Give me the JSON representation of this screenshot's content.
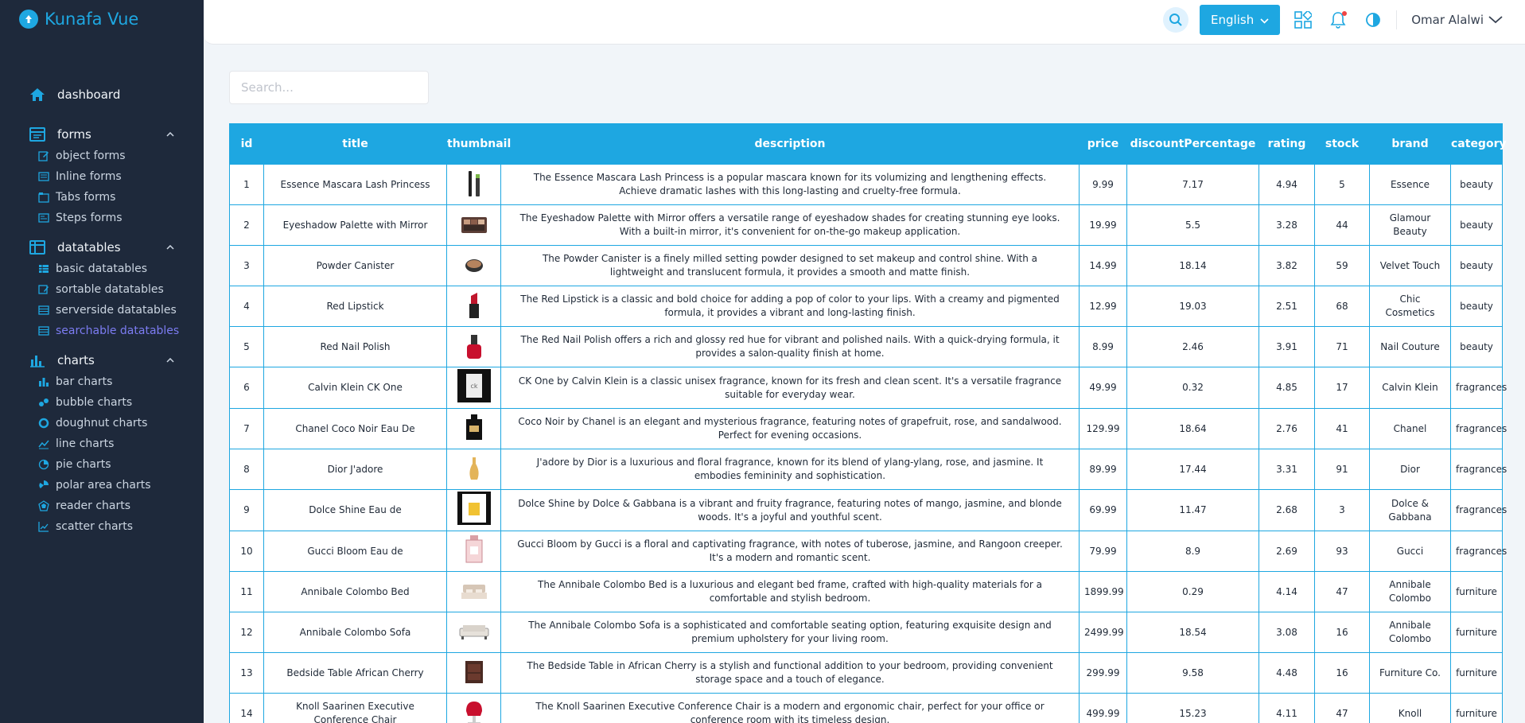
{
  "app": {
    "title": "Kunafa Vue"
  },
  "sidebar": {
    "top": {
      "label": "dashboard",
      "icon": "home-icon"
    },
    "groups": [
      {
        "label": "forms",
        "icon": "forms-icon",
        "items": [
          {
            "label": "object forms",
            "icon": "edit-icon"
          },
          {
            "label": "Inline forms",
            "icon": "inline-icon"
          },
          {
            "label": "Tabs forms",
            "icon": "tabs-icon"
          },
          {
            "label": "Steps forms",
            "icon": "steps-icon"
          }
        ]
      },
      {
        "label": "datatables",
        "icon": "table-icon",
        "items": [
          {
            "label": "basic datatables",
            "icon": "table-icon"
          },
          {
            "label": "sortable datatables",
            "icon": "sort-icon"
          },
          {
            "label": "serverside datatables",
            "icon": "list-icon"
          },
          {
            "label": "searchable datatables",
            "icon": "list-icon",
            "active": true
          }
        ]
      },
      {
        "label": "charts",
        "icon": "bar-chart-icon",
        "items": [
          {
            "label": "bar charts",
            "icon": "bar-chart-icon"
          },
          {
            "label": "bubble charts",
            "icon": "bubble-icon"
          },
          {
            "label": "doughnut charts",
            "icon": "doughnut-icon"
          },
          {
            "label": "line charts",
            "icon": "line-chart-icon"
          },
          {
            "label": "pie charts",
            "icon": "pie-icon"
          },
          {
            "label": "polar area charts",
            "icon": "polar-icon"
          },
          {
            "label": "reader charts",
            "icon": "radar-icon"
          },
          {
            "label": "scatter charts",
            "icon": "scatter-icon"
          }
        ]
      }
    ]
  },
  "header": {
    "language": "English",
    "user_name": "Omar Alalwi"
  },
  "search": {
    "placeholder": "Search...",
    "value": ""
  },
  "table": {
    "columns": [
      "id",
      "title",
      "thumbnail",
      "description",
      "price",
      "discountPercentage",
      "rating",
      "stock",
      "brand",
      "category"
    ],
    "rows": [
      {
        "id": "1",
        "title": "Essence Mascara Lash Princess",
        "thumbnail": "mascara",
        "description": "The Essence Mascara Lash Princess is a popular mascara known for its volumizing and lengthening effects. Achieve dramatic lashes with this long-lasting and cruelty-free formula.",
        "price": "9.99",
        "discountPercentage": "7.17",
        "rating": "4.94",
        "stock": "5",
        "brand": "Essence",
        "category": "beauty"
      },
      {
        "id": "2",
        "title": "Eyeshadow Palette with Mirror",
        "thumbnail": "palette",
        "description": "The Eyeshadow Palette with Mirror offers a versatile range of eyeshadow shades for creating stunning eye looks. With a built-in mirror, it's convenient for on-the-go makeup application.",
        "price": "19.99",
        "discountPercentage": "5.5",
        "rating": "3.28",
        "stock": "44",
        "brand": "Glamour Beauty",
        "category": "beauty"
      },
      {
        "id": "3",
        "title": "Powder Canister",
        "thumbnail": "powder",
        "description": "The Powder Canister is a finely milled setting powder designed to set makeup and control shine. With a lightweight and translucent formula, it provides a smooth and matte finish.",
        "price": "14.99",
        "discountPercentage": "18.14",
        "rating": "3.82",
        "stock": "59",
        "brand": "Velvet Touch",
        "category": "beauty"
      },
      {
        "id": "4",
        "title": "Red Lipstick",
        "thumbnail": "lipstick",
        "description": "The Red Lipstick is a classic and bold choice for adding a pop of color to your lips. With a creamy and pigmented formula, it provides a vibrant and long-lasting finish.",
        "price": "12.99",
        "discountPercentage": "19.03",
        "rating": "2.51",
        "stock": "68",
        "brand": "Chic Cosmetics",
        "category": "beauty"
      },
      {
        "id": "5",
        "title": "Red Nail Polish",
        "thumbnail": "nailpolish",
        "description": "The Red Nail Polish offers a rich and glossy red hue for vibrant and polished nails. With a quick-drying formula, it provides a salon-quality finish at home.",
        "price": "8.99",
        "discountPercentage": "2.46",
        "rating": "3.91",
        "stock": "71",
        "brand": "Nail Couture",
        "category": "beauty"
      },
      {
        "id": "6",
        "title": "Calvin Klein CK One",
        "thumbnail": "ckone",
        "description": "CK One by Calvin Klein is a classic unisex fragrance, known for its fresh and clean scent. It's a versatile fragrance suitable for everyday wear.",
        "price": "49.99",
        "discountPercentage": "0.32",
        "rating": "4.85",
        "stock": "17",
        "brand": "Calvin Klein",
        "category": "fragrances"
      },
      {
        "id": "7",
        "title": "Chanel Coco Noir Eau De",
        "thumbnail": "coconoir",
        "description": "Coco Noir by Chanel is an elegant and mysterious fragrance, featuring notes of grapefruit, rose, and sandalwood. Perfect for evening occasions.",
        "price": "129.99",
        "discountPercentage": "18.64",
        "rating": "2.76",
        "stock": "41",
        "brand": "Chanel",
        "category": "fragrances"
      },
      {
        "id": "8",
        "title": "Dior J'adore",
        "thumbnail": "jadore",
        "description": "J'adore by Dior is a luxurious and floral fragrance, known for its blend of ylang-ylang, rose, and jasmine. It embodies femininity and sophistication.",
        "price": "89.99",
        "discountPercentage": "17.44",
        "rating": "3.31",
        "stock": "91",
        "brand": "Dior",
        "category": "fragrances"
      },
      {
        "id": "9",
        "title": "Dolce Shine Eau de",
        "thumbnail": "dolceshine",
        "description": "Dolce Shine by Dolce & Gabbana is a vibrant and fruity fragrance, featuring notes of mango, jasmine, and blonde woods. It's a joyful and youthful scent.",
        "price": "69.99",
        "discountPercentage": "11.47",
        "rating": "2.68",
        "stock": "3",
        "brand": "Dolce & Gabbana",
        "category": "fragrances"
      },
      {
        "id": "10",
        "title": "Gucci Bloom Eau de",
        "thumbnail": "gucci",
        "description": "Gucci Bloom by Gucci is a floral and captivating fragrance, with notes of tuberose, jasmine, and Rangoon creeper. It's a modern and romantic scent.",
        "price": "79.99",
        "discountPercentage": "8.9",
        "rating": "2.69",
        "stock": "93",
        "brand": "Gucci",
        "category": "fragrances"
      },
      {
        "id": "11",
        "title": "Annibale Colombo Bed",
        "thumbnail": "bed",
        "description": "The Annibale Colombo Bed is a luxurious and elegant bed frame, crafted with high-quality materials for a comfortable and stylish bedroom.",
        "price": "1899.99",
        "discountPercentage": "0.29",
        "rating": "4.14",
        "stock": "47",
        "brand": "Annibale Colombo",
        "category": "furniture"
      },
      {
        "id": "12",
        "title": "Annibale Colombo Sofa",
        "thumbnail": "sofa",
        "description": "The Annibale Colombo Sofa is a sophisticated and comfortable seating option, featuring exquisite design and premium upholstery for your living room.",
        "price": "2499.99",
        "discountPercentage": "18.54",
        "rating": "3.08",
        "stock": "16",
        "brand": "Annibale Colombo",
        "category": "furniture"
      },
      {
        "id": "13",
        "title": "Bedside Table African Cherry",
        "thumbnail": "bedside",
        "description": "The Bedside Table in African Cherry is a stylish and functional addition to your bedroom, providing convenient storage space and a touch of elegance.",
        "price": "299.99",
        "discountPercentage": "9.58",
        "rating": "4.48",
        "stock": "16",
        "brand": "Furniture Co.",
        "category": "furniture"
      },
      {
        "id": "14",
        "title": "Knoll Saarinen Executive Conference Chair",
        "thumbnail": "chair",
        "description": "The Knoll Saarinen Executive Conference Chair is a modern and ergonomic chair, perfect for your office or conference room with its timeless design.",
        "price": "499.99",
        "discountPercentage": "15.23",
        "rating": "4.11",
        "stock": "47",
        "brand": "Knoll",
        "category": "furniture"
      }
    ]
  },
  "colors": {
    "accent": "#1ea7e1",
    "sidebar": "#1e293b",
    "active": "#7c7cf2"
  }
}
